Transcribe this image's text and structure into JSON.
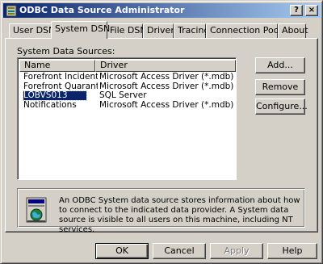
{
  "window": {
    "title": "ODBC Data Source Administrator"
  },
  "caption_buttons": {
    "help": "?",
    "close": "×"
  },
  "tabs": [
    {
      "label": "User DSN",
      "active": false
    },
    {
      "label": "System DSN",
      "active": true
    },
    {
      "label": "File DSN",
      "active": false
    },
    {
      "label": "Drivers",
      "active": false
    },
    {
      "label": "Tracing",
      "active": false
    },
    {
      "label": "Connection Pooling",
      "active": false
    },
    {
      "label": "About",
      "active": false
    }
  ],
  "system_dsn": {
    "section_label": "System Data Sources:",
    "columns": {
      "name": "Name",
      "driver": "Driver"
    },
    "rows": [
      {
        "name": "Forefront Incidents",
        "driver": "Microsoft Access Driver (*.mdb)",
        "selected": false
      },
      {
        "name": "Forefront Quarantine",
        "driver": "Microsoft Access Driver (*.mdb)",
        "selected": false
      },
      {
        "name": "LOBVS013",
        "driver": "SQL Server",
        "selected": true
      },
      {
        "name": "Notifications",
        "driver": "Microsoft Access Driver (*.mdb)",
        "selected": false
      }
    ],
    "side_buttons": {
      "add": "Add...",
      "remove": "Remove",
      "configure": "Configure..."
    },
    "info_text": "An ODBC System data source stores information about how to connect to the indicated data provider.  A System data source is visible to all users on this machine, including NT services.",
    "info_icon": "network-globe-icon"
  },
  "footer_buttons": {
    "ok": "OK",
    "cancel": "Cancel",
    "apply": "Apply",
    "help": "Help"
  }
}
